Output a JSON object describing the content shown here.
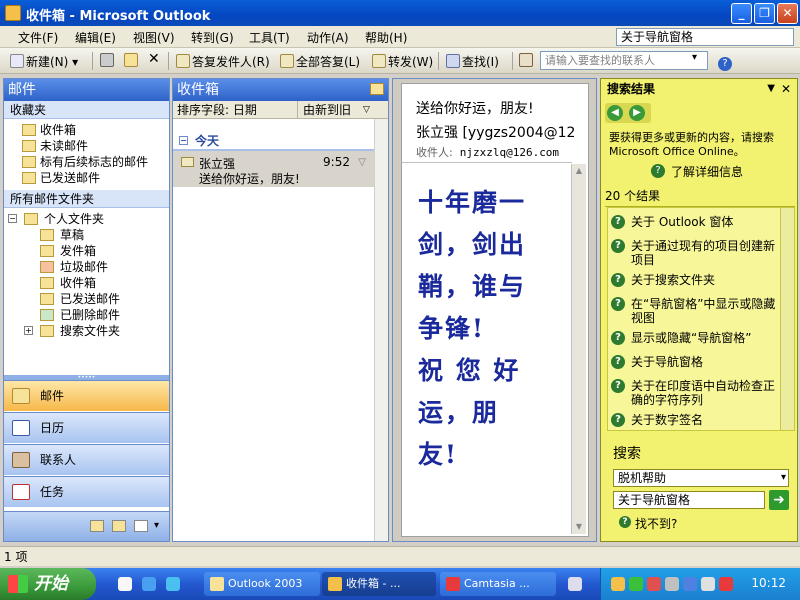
{
  "window": {
    "title": "收件箱 - Microsoft Outlook"
  },
  "menu": {
    "items": [
      "文件(F)",
      "编辑(E)",
      "视图(V)",
      "转到(G)",
      "工具(T)",
      "动作(A)",
      "帮助(H)"
    ],
    "help_box": "关于导航窗格"
  },
  "toolbar": {
    "new_label": "新建(N)",
    "reply": "答复发件人(R)",
    "reply_all": "全部答复(L)",
    "forward": "转发(W)",
    "find": "查找(I)",
    "contact_placeholder": "请输入要查找的联系人"
  },
  "nav": {
    "title": "邮件",
    "favorites_label": "收藏夹",
    "favorites": [
      "收件箱",
      "未读邮件",
      "标有后续标志的邮件",
      "已发送邮件"
    ],
    "all_folders_label": "所有邮件文件夹",
    "personal_folders": "个人文件夹",
    "folders": [
      "草稿",
      "发件箱",
      "垃圾邮件",
      "收件箱",
      "已发送邮件",
      "已删除邮件",
      "搜索文件夹"
    ],
    "buttons": [
      "邮件",
      "日历",
      "联系人",
      "任务"
    ]
  },
  "list": {
    "title": "收件箱",
    "sort_field": "排序字段: 日期",
    "sort_order": "由新到旧",
    "group": "今天",
    "message": {
      "from": "张立强",
      "time": "9:52",
      "subject": "送给你好运，朋友!"
    }
  },
  "reading": {
    "subject": "送给你好运，朋友!",
    "from": "张立强 [yygzs2004@12",
    "to_label": "收件人:",
    "to": "njzxzlq@126.com",
    "body": [
      "十年磨一",
      "剑，剑出",
      "鞘，谁与",
      "争锋!",
      "祝 您 好",
      "运，朋",
      "友!"
    ]
  },
  "search": {
    "title": "搜索结果",
    "info": "要获得更多或更新的内容，请搜索 Microsoft Office Online。",
    "detail_link": "了解详细信息",
    "count": "20 个结果",
    "results": [
      "关于 Outlook 窗体",
      "关于通过现有的项目创建新项目",
      "关于搜索文件夹",
      "在“导航窗格”中显示或隐藏视图",
      "显示或隐藏“导航窗格”",
      "关于导航窗格",
      "关于在印度语中自动检查正确的字符序列",
      "关于数字签名"
    ],
    "search_label": "搜索",
    "scope": "脱机帮助",
    "query": "关于导航窗格",
    "not_found": "找不到?"
  },
  "status": {
    "items": "1 项"
  },
  "taskbar": {
    "start": "开始",
    "tasks": [
      "Outlook 2003",
      "收件箱 - ...",
      "Camtasia ..."
    ],
    "clock": "10:12"
  },
  "colors": {
    "accent": "#2e62c8",
    "search_bg": "#f2f270",
    "body_text": "#1a2a9c"
  }
}
